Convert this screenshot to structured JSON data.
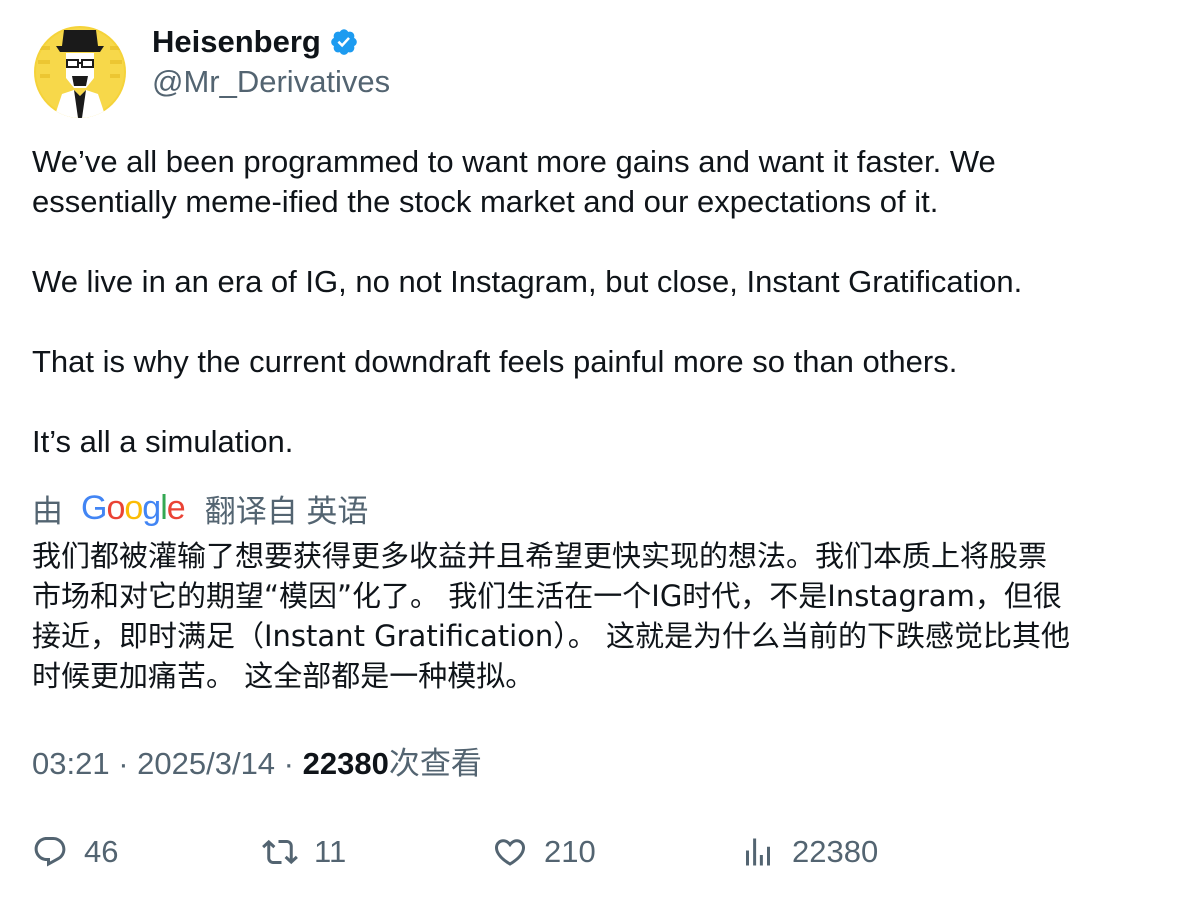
{
  "author": {
    "display_name": "Heisenberg",
    "handle": "@Mr_Derivatives",
    "verified": true,
    "avatar_icon": "heisenberg-avatar-icon"
  },
  "tweet": {
    "paragraphs": [
      [
        "We’ve all been programmed to want more gains and want it faster. We",
        "essentially meme-ified the stock market and our expectations of it."
      ],
      [
        "We live in an era of IG, no not Instagram, but close, Instant Gratification."
      ],
      [
        "That is why the current downdraft feels painful more so than others."
      ],
      [
        "It’s all a simulation."
      ]
    ]
  },
  "translation": {
    "by_label": "由",
    "provider": "Google",
    "translated_from_label": "翻译自 英语",
    "lines": [
      "我们都被灌输了想要获得更多收益并且希望更快实现的想法。我们本质上将股票",
      "市场和对它的期望“模因”化了。 我们生活在一个IG时代，不是Instagram，但很",
      "接近，即时满足（Instant Gratification）。 这就是为什么当前的下跌感觉比其他",
      "时候更加痛苦。 这全部都是一种模拟。"
    ]
  },
  "meta": {
    "time": "03:21",
    "separator": " · ",
    "date": "2025/3/14",
    "views_count": "22380",
    "views_label": "次查看"
  },
  "actions": {
    "reply": {
      "icon": "reply-icon",
      "count": "46"
    },
    "retweet": {
      "icon": "retweet-icon",
      "count": "11"
    },
    "like": {
      "icon": "heart-icon",
      "count": "210"
    },
    "views": {
      "icon": "analytics-icon",
      "count": "22380"
    }
  },
  "colors": {
    "text_primary": "#0f1419",
    "text_secondary": "#536471",
    "verified_blue": "#1d9bf0",
    "avatar_yellow": "#f5d33a"
  }
}
